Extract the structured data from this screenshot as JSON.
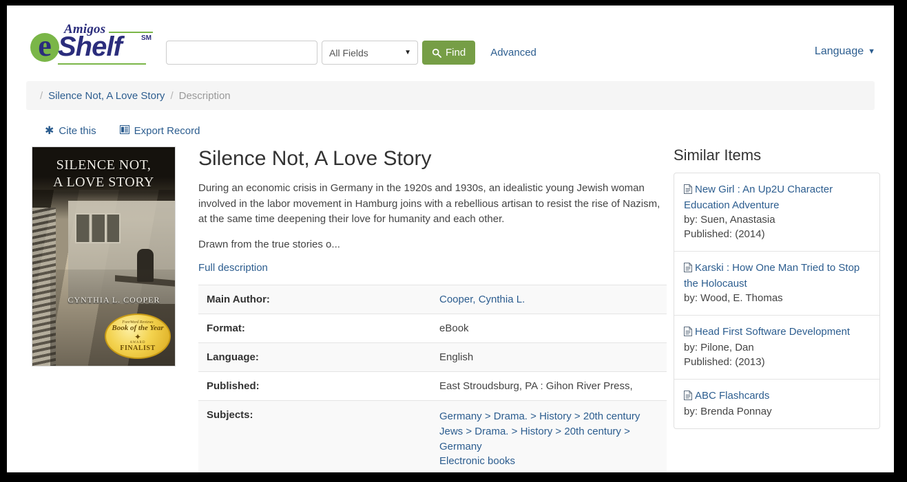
{
  "header": {
    "logo": {
      "amigos": "Amigos",
      "e": "e",
      "shelf": "Shelf",
      "sm": "SM"
    },
    "search": {
      "value": "",
      "placeholder": "",
      "field_selected": "All Fields",
      "find_label": "Find",
      "advanced_label": "Advanced"
    },
    "language_label": "Language"
  },
  "breadcrumb": {
    "sep": "/",
    "items": [
      {
        "label": "Silence Not, A Love Story",
        "current": false
      },
      {
        "label": "Description",
        "current": true
      }
    ]
  },
  "record_actions": [
    {
      "label": "Cite this",
      "icon": "asterisk-icon"
    },
    {
      "label": "Export Record",
      "icon": "export-icon"
    }
  ],
  "cover": {
    "title_line1": "SILENCE NOT,",
    "title_line2": "A LOVE STORY",
    "author": "CYNTHIA L. COOPER",
    "seal": {
      "line1": "ForeWord Reviews",
      "line2": "Book of the Year",
      "star": "✦",
      "line3": "AWARD",
      "line4": "FINALIST"
    }
  },
  "record": {
    "title": "Silence Not, A Love Story",
    "description_1": "During an economic crisis in Germany in the 1920s and 1930s, an idealistic young Jewish woman involved in the labor movement in Hamburg joins with a rebellious artisan to resist the rise of Nazism, at the same time deepening their love for humanity and each other.",
    "description_2": "Drawn from the true stories o...",
    "full_description_label": "Full description",
    "fields": [
      {
        "label": "Main Author:",
        "value": "Cooper, Cynthia L.",
        "link": true
      },
      {
        "label": "Format:",
        "value": "eBook",
        "link": false
      },
      {
        "label": "Language:",
        "value": "English",
        "link": false
      },
      {
        "label": "Published:",
        "value": "East Stroudsburg, PA : Gihon River Press,",
        "link": false
      }
    ],
    "subjects_label": "Subjects:",
    "subjects": [
      [
        "Germany",
        "Drama.",
        "History",
        "20th century"
      ],
      [
        "Jews",
        "Drama.",
        "History",
        "20th century",
        "Germany"
      ],
      [
        "Electronic books"
      ]
    ],
    "subject_separator": ">"
  },
  "sidebar": {
    "title": "Similar Items",
    "items": [
      {
        "title": "New Girl : An Up2U Character Education Adventure",
        "by": "by: Suen, Anastasia",
        "published": "Published: (2014)"
      },
      {
        "title": "Karski : How One Man Tried to Stop the Holocaust",
        "by": "by: Wood, E. Thomas",
        "published": ""
      },
      {
        "title": "Head First Software Development",
        "by": "by: Pilone, Dan",
        "published": "Published: (2013)"
      },
      {
        "title": "ABC Flashcards",
        "by": "by: Brenda Ponnay",
        "published": ""
      }
    ]
  },
  "colors": {
    "brand_green": "#7ab648",
    "brand_blue": "#2b2d7c",
    "button_green": "#769e46",
    "link_blue": "#2c5d8f",
    "muted_gray": "#999999",
    "row_alt": "#f9f9f9"
  }
}
